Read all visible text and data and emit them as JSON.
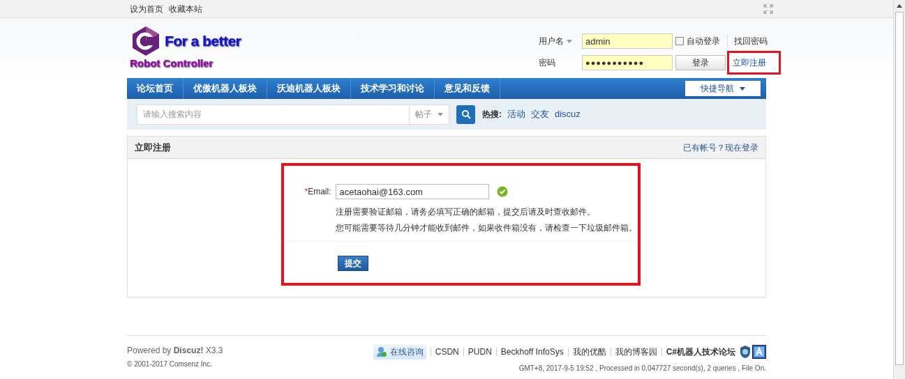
{
  "top_links": [
    "设为首页",
    "收藏本站"
  ],
  "logo": {
    "line1": "For a better",
    "line2": "Robot Controller"
  },
  "login": {
    "username_label": "用户名",
    "username": "admin",
    "password_label": "密码",
    "password": "●●●●●●●●●●●",
    "auto_login": {
      "label": "自动登录",
      "checked": false
    },
    "login_button": "登录",
    "forgot": "找回密码",
    "register": "立即注册"
  },
  "nav": {
    "items": [
      {
        "label": "论坛首页",
        "selected": false
      },
      {
        "label": "优傲机器人板块",
        "selected": false
      },
      {
        "label": "沃迪机器人板块",
        "selected": false
      },
      {
        "label": "技术学习和讨论",
        "selected": false
      },
      {
        "label": "意见和反馈",
        "selected": false
      }
    ],
    "quick_nav": "快捷导航"
  },
  "search": {
    "placeholder": "请输入搜索内容",
    "type": "帖子",
    "hot_label": "热搜:",
    "hot": [
      "活动",
      "交友",
      "discuz"
    ]
  },
  "panel": {
    "title": "立即注册",
    "login_link": "已有帐号？现在登录",
    "email_required": "*",
    "email_label": "Email:",
    "email": "acetaohai@163.com",
    "valid": true,
    "notes": [
      "注册需要验证邮箱，请务必填写正确的邮箱，提交后请及时查收邮件。",
      "您可能需要等待几分钟才能收到邮件，如果收件箱没有，请检查一下垃圾邮件箱。"
    ],
    "submit": "提交"
  },
  "footer": {
    "powered": "Powered by **Discuz!** X3.3",
    "copyright": "© 2001-2017 Comsenz Inc.",
    "consult": "在线咨询",
    "links": [
      "CSDN",
      "PUDN",
      "Beckhoff InfoSys",
      "我的优酷",
      "我的博客园"
    ],
    "site_name": "C#机器人技术论坛",
    "stats": "GMT+8, 2017-9-5 19:52 , Processed in 0.047727 second(s), 2 queries , File On."
  }
}
